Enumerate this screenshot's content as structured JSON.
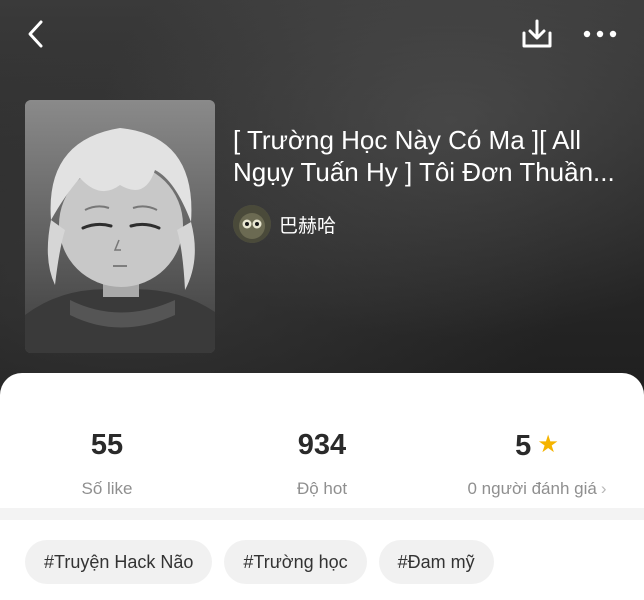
{
  "header": {
    "back_icon": "chevron-left-icon",
    "download_icon": "download-icon",
    "more_icon": "more-horizontal-icon"
  },
  "story": {
    "title_line1": "[ Trường Học Này Có Ma ][ All",
    "title_line2": "Ngụy Tuấn Hy ] Tôi Đơn Thuần...",
    "author": "巴赫哈"
  },
  "stats": [
    {
      "value": "55",
      "label": "Số like"
    },
    {
      "value": "934",
      "label": "Độ hot"
    },
    {
      "value": "5",
      "label": "0 người đánh giá"
    }
  ],
  "tags": [
    "#Truyện Hack Não",
    "#Trường học",
    "#Đam mỹ"
  ],
  "colors": {
    "star": "#f5b400",
    "hero_bg": "#2b2b2b",
    "tag_bg": "#f1f1f1",
    "label_gray": "#8f8f8f"
  }
}
